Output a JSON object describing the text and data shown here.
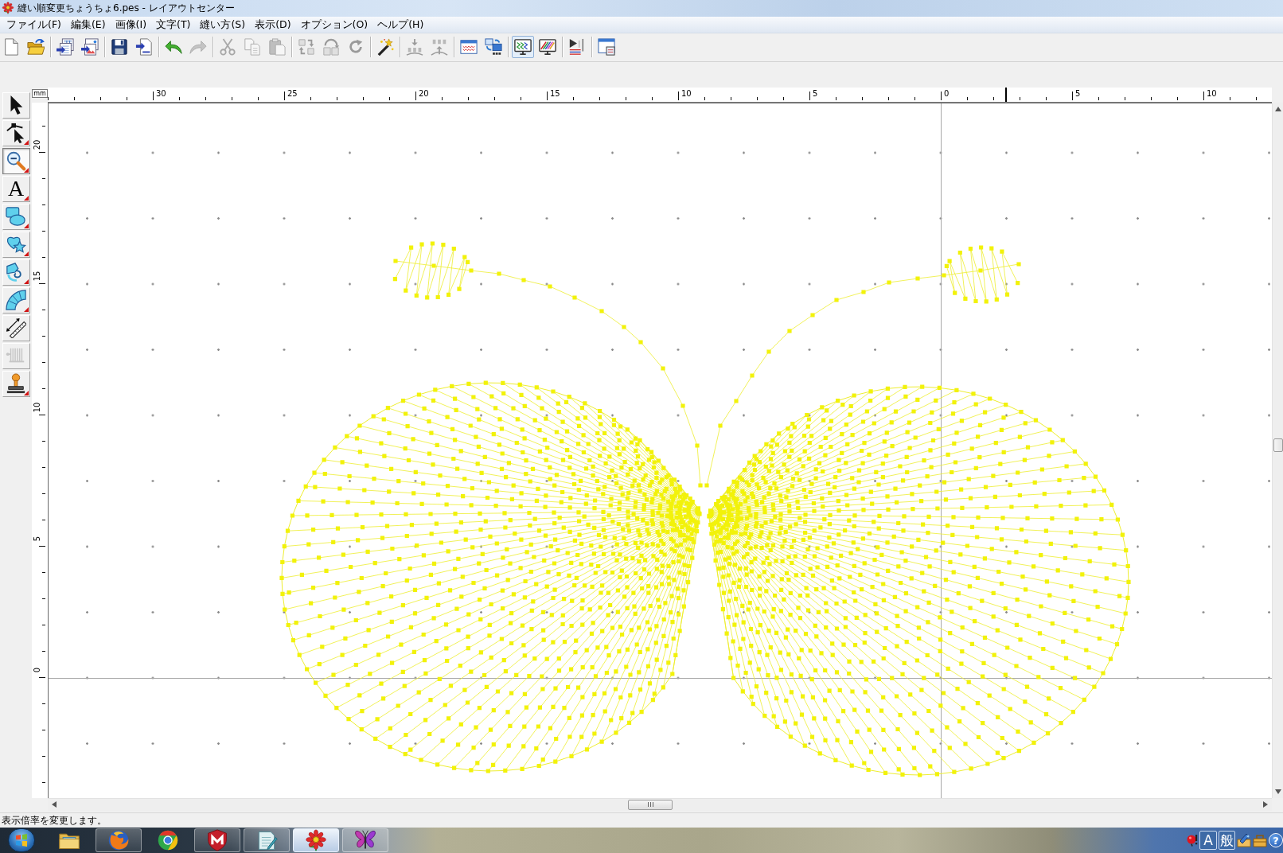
{
  "window": {
    "title": "縫い順変更ちょうちょ6.pes - レイアウトセンター"
  },
  "menu": [
    "ファイル(F)",
    "編集(E)",
    "画像(I)",
    "文字(T)",
    "縫い方(S)",
    "表示(D)",
    "オプション(O)",
    "ヘルプ(H)"
  ],
  "toolbar": {
    "groups": [
      {
        "items": [
          {
            "disabled": false,
            "pressed": false
          },
          {
            "disabled": false,
            "pressed": false
          }
        ]
      },
      {
        "items": [
          {
            "disabled": false,
            "pressed": false
          },
          {
            "disabled": false,
            "pressed": false
          }
        ]
      },
      {
        "items": [
          {
            "disabled": false,
            "pressed": false
          },
          {
            "disabled": false,
            "pressed": false
          }
        ]
      },
      {
        "items": [
          {
            "disabled": false,
            "pressed": false
          },
          {
            "disabled": true,
            "pressed": false
          }
        ]
      },
      {
        "items": [
          {
            "disabled": true,
            "pressed": false
          },
          {
            "disabled": true,
            "pressed": false
          },
          {
            "disabled": true,
            "pressed": false
          }
        ]
      },
      {
        "items": [
          {
            "disabled": true,
            "pressed": false
          },
          {
            "disabled": true,
            "pressed": false
          },
          {
            "disabled": true,
            "pressed": false
          }
        ]
      },
      {
        "items": [
          {
            "disabled": false,
            "pressed": false
          }
        ]
      },
      {
        "items": [
          {
            "disabled": true,
            "pressed": false
          },
          {
            "disabled": true,
            "pressed": false
          }
        ]
      },
      {
        "items": [
          {
            "disabled": false,
            "pressed": false
          },
          {
            "disabled": false,
            "pressed": false
          }
        ]
      },
      {
        "items": [
          {
            "disabled": false,
            "pressed": true
          },
          {
            "disabled": false,
            "pressed": false
          }
        ]
      },
      {
        "items": [
          {
            "disabled": false,
            "pressed": false
          }
        ]
      },
      {
        "items": [
          {
            "disabled": false,
            "pressed": false
          }
        ]
      }
    ]
  },
  "tools": [
    {
      "selected": false,
      "disabled": false,
      "flyout": false
    },
    {
      "selected": false,
      "disabled": false,
      "flyout": true
    },
    {
      "selected": true,
      "disabled": false,
      "flyout": true
    },
    {
      "glyph": "A",
      "selected": false,
      "disabled": false,
      "flyout": true
    },
    {
      "selected": false,
      "disabled": false,
      "flyout": true
    },
    {
      "selected": false,
      "disabled": false,
      "flyout": true
    },
    {
      "selected": false,
      "disabled": false,
      "flyout": true
    },
    {
      "selected": false,
      "disabled": false,
      "flyout": true
    },
    {
      "selected": false,
      "disabled": false,
      "flyout": false
    },
    {
      "selected": false,
      "disabled": true,
      "flyout": false
    },
    {
      "selected": false,
      "disabled": false,
      "flyout": true
    }
  ],
  "ruler": {
    "unit": "mm",
    "top_labels": [
      "30",
      "25",
      "20",
      "15",
      "10",
      "5",
      "0",
      "5",
      "10"
    ],
    "left_labels": [
      "20",
      "15",
      "10",
      "5",
      "0"
    ]
  },
  "status_bar": {
    "text": "表示倍率を変更します。"
  },
  "taskbar": {
    "items": [
      {
        "running": false,
        "selected": false
      },
      {
        "running": true,
        "selected": false
      },
      {
        "running": false,
        "selected": false
      },
      {
        "running": true,
        "selected": false
      },
      {
        "running": true,
        "selected": false
      },
      {
        "running": true,
        "selected": true
      },
      {
        "running": true,
        "selected": false
      }
    ]
  },
  "tray": {
    "ime_mode": "A",
    "ime_input": "般",
    "help": "?"
  }
}
